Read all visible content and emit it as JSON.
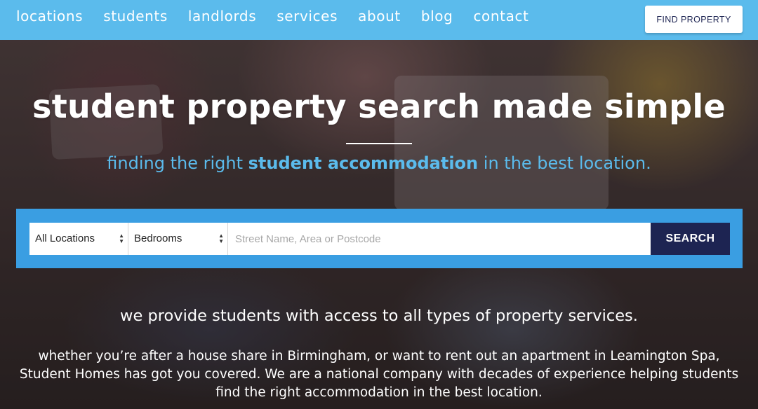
{
  "nav": {
    "items": [
      "locations",
      "students",
      "landlords",
      "services",
      "about",
      "blog",
      "contact"
    ],
    "cta_label": "FIND PROPERTY"
  },
  "hero": {
    "title": "student property search made simple",
    "subtitle_pre": "finding the right ",
    "subtitle_bold": "student accommodation",
    "subtitle_post": " in the best location."
  },
  "search": {
    "location_selected": "All Locations",
    "bedrooms_selected": "Bedrooms",
    "query_placeholder": "Street Name, Area or Postcode",
    "query_value": "",
    "button_label": "SEARCH"
  },
  "intro": {
    "lead": "we provide students with access to all types of property services.",
    "body": "whether you’re after a house share in Birmingham, or want to rent out an apartment in Leamington Spa, Student Homes has got you covered. We are a national company with decades of experience helping students find the right accommodation in the best location."
  },
  "colors": {
    "nav_bar": "#5bbbec",
    "search_panel": "#3a9ee2",
    "search_button": "#1d2452",
    "accent_text": "#5bbbec"
  }
}
